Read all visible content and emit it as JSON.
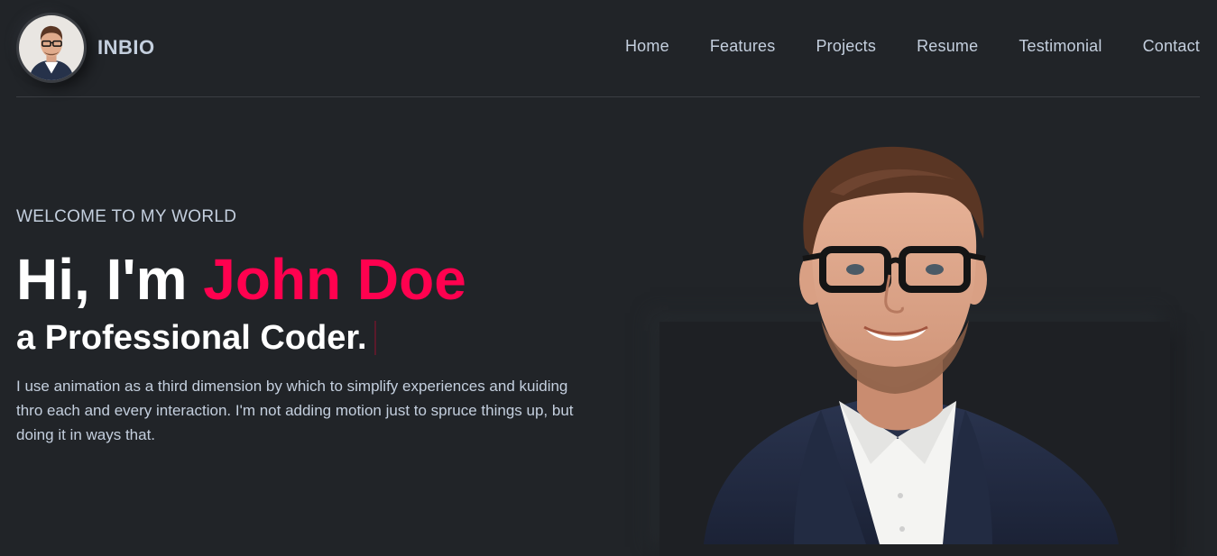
{
  "header": {
    "brand": "INBIO",
    "nav": [
      {
        "label": "Home"
      },
      {
        "label": "Features"
      },
      {
        "label": "Projects"
      },
      {
        "label": "Resume"
      },
      {
        "label": "Testimonial"
      },
      {
        "label": "Contact"
      }
    ]
  },
  "hero": {
    "welcome": "WELCOME TO MY WORLD",
    "greeting": "Hi, I'm ",
    "name": "John Doe",
    "subtitle": "a Professional Coder.",
    "description": "I use animation as a third dimension by which to simplify experiences and kuiding thro each and every interaction. I'm not adding motion just to spruce things up, but doing it in ways that."
  },
  "colors": {
    "background": "#212428",
    "accent": "#ff014f",
    "text": "#c4cfde"
  },
  "icons": {
    "avatar": "person-avatar",
    "portrait": "person-portrait"
  }
}
